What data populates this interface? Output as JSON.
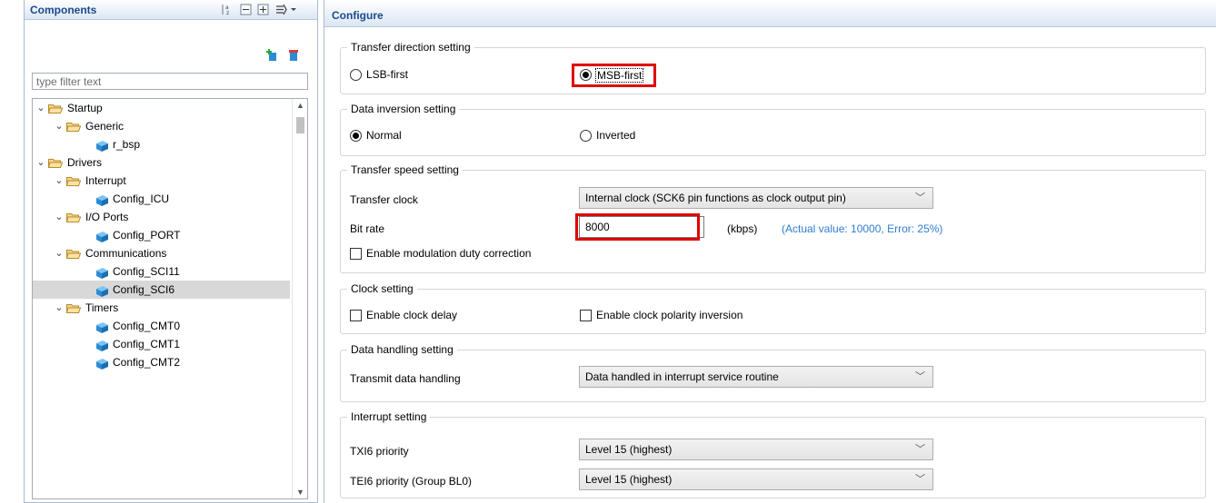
{
  "components_panel": {
    "title": "Components",
    "filter_placeholder": "type filter text",
    "toolbar_icons": [
      "sort-icon",
      "collapse-all-icon",
      "expand-all-icon",
      "view-menu-icon"
    ],
    "action_icons": [
      "add-component-icon",
      "remove-component-icon"
    ],
    "tree": [
      {
        "label": "Startup",
        "type": "folder",
        "level": 0,
        "expanded": true
      },
      {
        "label": "Generic",
        "type": "folder",
        "level": 1,
        "expanded": true
      },
      {
        "label": "r_bsp",
        "type": "component",
        "level": 2
      },
      {
        "label": "Drivers",
        "type": "folder",
        "level": 0,
        "expanded": true
      },
      {
        "label": "Interrupt",
        "type": "folder",
        "level": 1,
        "expanded": true
      },
      {
        "label": "Config_ICU",
        "type": "component",
        "level": 2
      },
      {
        "label": "I/O Ports",
        "type": "folder",
        "level": 1,
        "expanded": true
      },
      {
        "label": "Config_PORT",
        "type": "component",
        "level": 2
      },
      {
        "label": "Communications",
        "type": "folder",
        "level": 1,
        "expanded": true
      },
      {
        "label": "Config_SCI11",
        "type": "component",
        "level": 2
      },
      {
        "label": "Config_SCI6",
        "type": "component",
        "level": 2,
        "selected": true
      },
      {
        "label": "Timers",
        "type": "folder",
        "level": 1,
        "expanded": true
      },
      {
        "label": "Config_CMT0",
        "type": "component",
        "level": 2
      },
      {
        "label": "Config_CMT1",
        "type": "component",
        "level": 2
      },
      {
        "label": "Config_CMT2",
        "type": "component",
        "level": 2
      }
    ]
  },
  "configure_panel": {
    "title": "Configure",
    "transfer_direction": {
      "legend": "Transfer direction setting",
      "options": [
        "LSB-first",
        "MSB-first"
      ],
      "selected": "MSB-first"
    },
    "data_inversion": {
      "legend": "Data inversion setting",
      "options": [
        "Normal",
        "Inverted"
      ],
      "selected": "Normal"
    },
    "transfer_speed": {
      "legend": "Transfer speed setting",
      "transfer_clock_label": "Transfer clock",
      "transfer_clock_value": "Internal clock (SCK6 pin functions as clock output pin)",
      "bit_rate_label": "Bit rate",
      "bit_rate_value": "8000",
      "bit_rate_unit": "(kbps)",
      "actual_value_note": "(Actual value: 10000, Error: 25%)",
      "modulation_label": "Enable modulation duty correction",
      "modulation_checked": false
    },
    "clock": {
      "legend": "Clock setting",
      "clock_delay_label": "Enable clock delay",
      "clock_delay_checked": false,
      "polarity_label": "Enable clock polarity inversion",
      "polarity_checked": false
    },
    "data_handling": {
      "legend": "Data handling setting",
      "transmit_label": "Transmit data handling",
      "transmit_value": "Data handled in interrupt service routine"
    },
    "interrupt": {
      "legend": "Interrupt setting",
      "txi_label": "TXI6 priority",
      "txi_value": "Level 15 (highest)",
      "tei_label": "TEI6 priority (Group BL0)",
      "tei_value": "Level 15 (highest)"
    }
  },
  "colors": {
    "highlight": "#e00000",
    "header_text": "#1b4a8a",
    "note_text": "#2f7cd3",
    "selection": "#d8d8d8"
  }
}
